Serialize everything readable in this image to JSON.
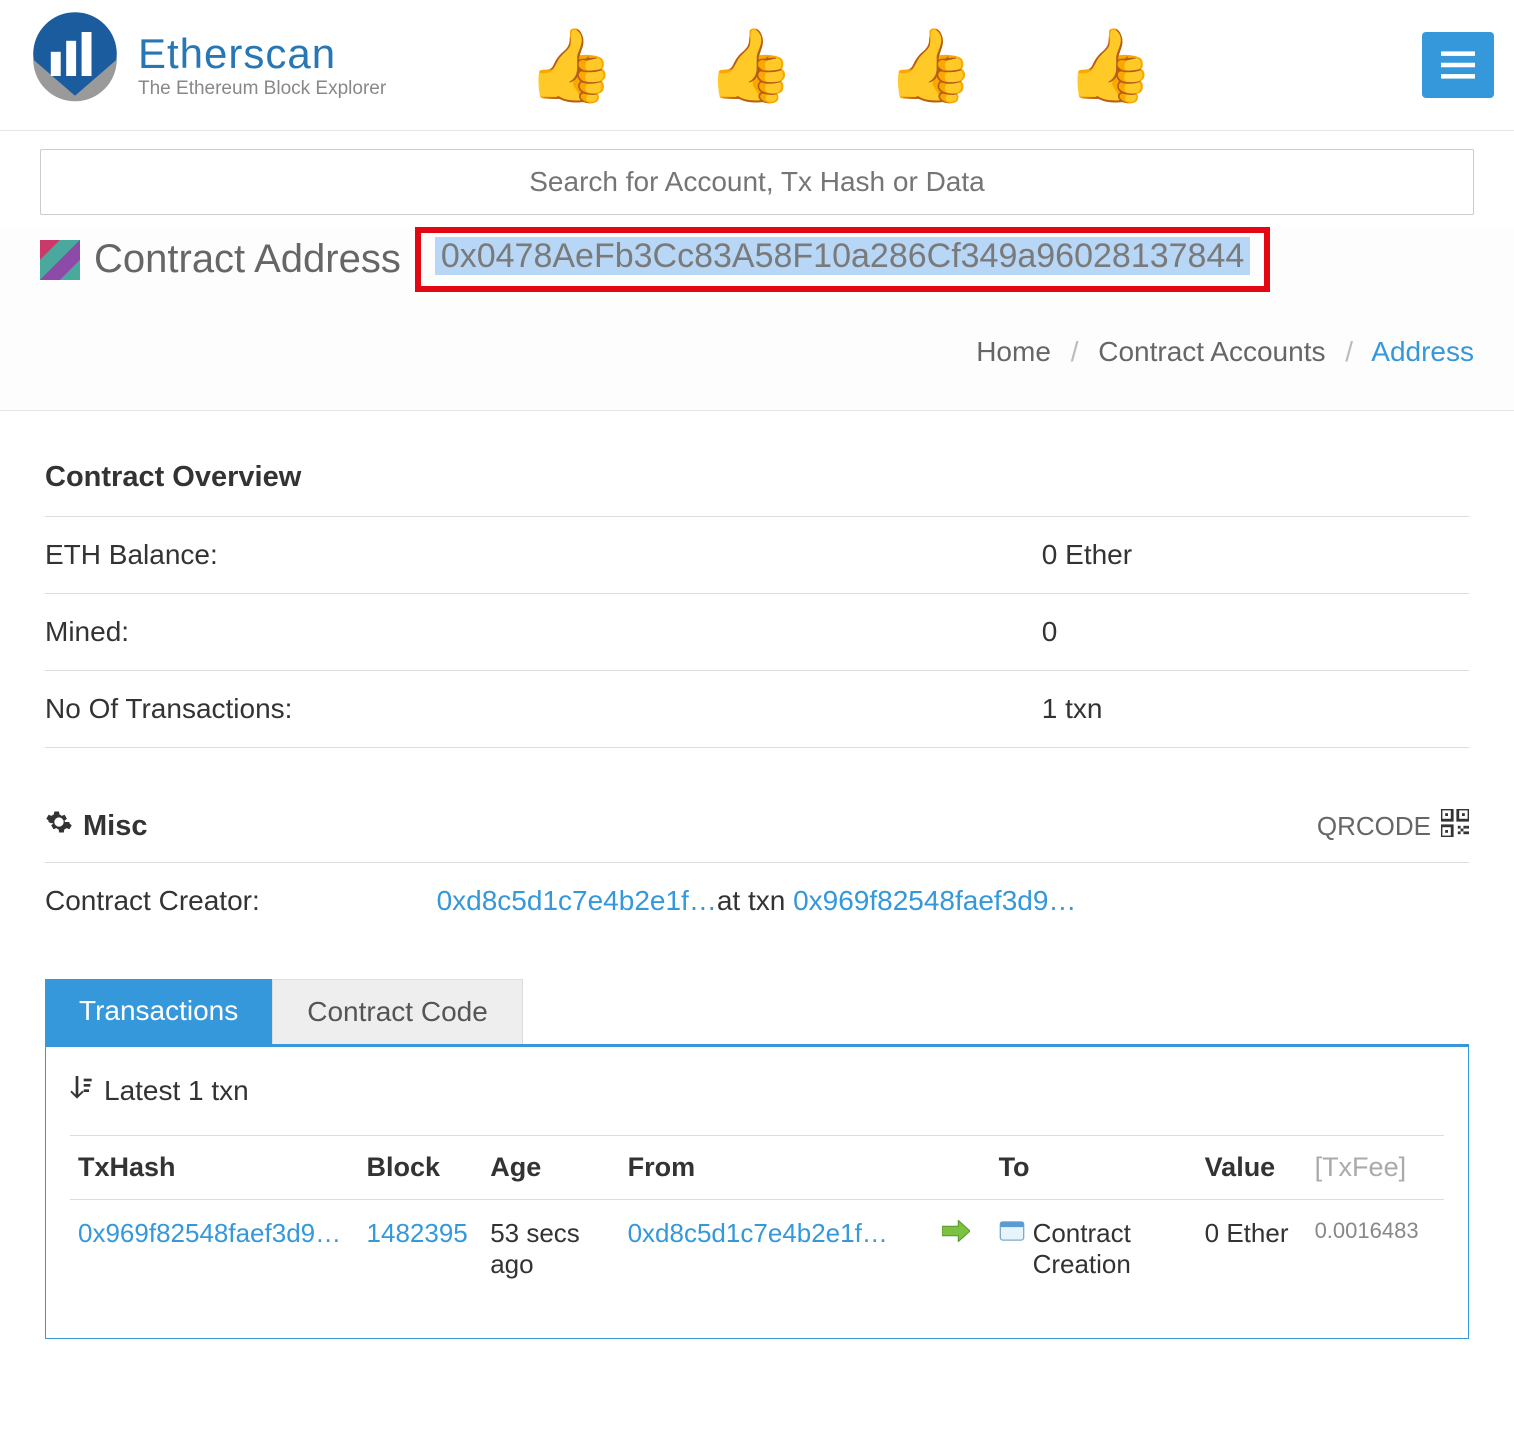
{
  "logo": {
    "title": "Etherscan",
    "subtitle": "The Ethereum Block Explorer"
  },
  "search": {
    "placeholder": "Search for Account, Tx Hash or Data"
  },
  "address": {
    "label": "Contract Address",
    "value": "0x0478AeFb3Cc83A58F10a286Cf349a96028137844"
  },
  "breadcrumb": {
    "home": "Home",
    "accounts": "Contract Accounts",
    "current": "Address"
  },
  "overview": {
    "title": "Contract Overview",
    "rows": [
      {
        "label": "ETH Balance:",
        "value": "0 Ether"
      },
      {
        "label": "Mined:",
        "value": "0"
      },
      {
        "label": "No Of Transactions:",
        "value": "1 txn"
      }
    ]
  },
  "misc": {
    "title": "Misc",
    "qrcode": "QRCODE",
    "creator_label": "Contract Creator:",
    "creator_addr": "0xd8c5d1c7e4b2e1f…",
    "at_txn": "at txn ",
    "creator_txn": "0x969f82548faef3d9…"
  },
  "tabs": {
    "transactions": "Transactions",
    "code": "Contract Code"
  },
  "tx_panel": {
    "latest": "Latest 1 txn",
    "headers": {
      "txhash": "TxHash",
      "block": "Block",
      "age": "Age",
      "from": "From",
      "to": "To",
      "value": "Value",
      "fee": "[TxFee]"
    },
    "row": {
      "txhash": "0x969f82548faef3d9…",
      "block": "1482395",
      "age": "53 secs ago",
      "from": "0xd8c5d1c7e4b2e1f…",
      "to": "Contract Creation",
      "value": "0 Ether",
      "fee": "0.0016483"
    }
  }
}
